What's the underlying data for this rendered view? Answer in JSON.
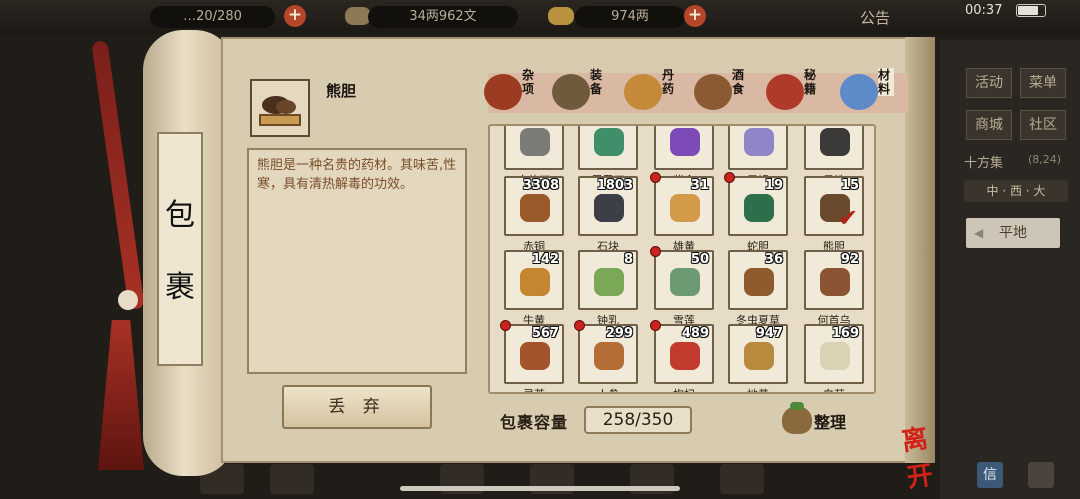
{
  "status": {
    "time": "00:37"
  },
  "topbar": {
    "capacity_text": "…20/280",
    "money": "34两962文",
    "gold": "974两",
    "notice": "公告",
    "add_label": "+"
  },
  "side": {
    "buttons": [
      "活动",
      "菜单",
      "商城",
      "社区"
    ],
    "location": "十方集",
    "coords": "(8,24)",
    "direction": "中 · 西 · 大",
    "place": "平地",
    "place_arrow": "◀",
    "letter": "信"
  },
  "scroll": {
    "char1": "包",
    "char2": "裹"
  },
  "item": {
    "name": "熊胆",
    "description": "熊胆是一种名贵的药材。其味苦,性寒，具有清热解毒的功效。"
  },
  "discard_label": "丢 弃",
  "tabs": [
    {
      "label": "杂项",
      "color": "#9a3b22"
    },
    {
      "label": "装备",
      "color": "#6f5b3c"
    },
    {
      "label": "丹药",
      "color": "#c48a3a"
    },
    {
      "label": "酒食",
      "color": "#8a5b33"
    },
    {
      "label": "秘籍",
      "color": "#b03a2a"
    },
    {
      "label": "材料",
      "color": "#5f8ac9"
    }
  ],
  "active_tab": "材料",
  "grid": {
    "rows": [
      [
        {
          "name": "白练石",
          "qty": "",
          "badge": false,
          "color": "#7d7b78"
        },
        {
          "name": "昆吾石",
          "qty": "",
          "badge": false,
          "color": "#3e8f6a"
        },
        {
          "name": "紫金",
          "qty": "",
          "badge": false,
          "color": "#7c4bb8"
        },
        {
          "name": "雪银",
          "qty": "",
          "badge": false,
          "color": "#8f86c9"
        },
        {
          "name": "黑铁",
          "qty": "",
          "badge": false,
          "color": "#3b3a38"
        }
      ],
      [
        {
          "name": "赤铜",
          "qty": "3308",
          "badge": false,
          "color": "#9b5a2a"
        },
        {
          "name": "石块",
          "qty": "1803",
          "badge": false,
          "color": "#3c3f45"
        },
        {
          "name": "雄黄",
          "qty": "31",
          "badge": true,
          "color": "#d39a47"
        },
        {
          "name": "蛇胆",
          "qty": "19",
          "badge": true,
          "color": "#2d6f4a"
        },
        {
          "name": "熊胆",
          "qty": "15",
          "badge": false,
          "color": "#6a4a2c",
          "selected": true
        }
      ],
      [
        {
          "name": "牛黄",
          "qty": "142",
          "badge": false,
          "color": "#c4862e"
        },
        {
          "name": "钟乳",
          "qty": "8",
          "badge": false,
          "color": "#7aa856"
        },
        {
          "name": "雪莲",
          "qty": "50",
          "badge": true,
          "color": "#6c9a72"
        },
        {
          "name": "冬虫夏草",
          "qty": "36",
          "badge": false,
          "color": "#8f5a2e"
        },
        {
          "name": "何首乌",
          "qty": "92",
          "badge": false,
          "color": "#8b5533"
        }
      ],
      [
        {
          "name": "灵芝",
          "qty": "567",
          "badge": true,
          "color": "#a4542c"
        },
        {
          "name": "人参",
          "qty": "299",
          "badge": true,
          "color": "#b46d34"
        },
        {
          "name": "枸杞",
          "qty": "489",
          "badge": true,
          "color": "#c33b2e"
        },
        {
          "name": "地黄",
          "qty": "947",
          "badge": false,
          "color": "#b78a3e"
        },
        {
          "name": "白芍",
          "qty": "169",
          "badge": false,
          "color": "#d9d2b4"
        }
      ]
    ]
  },
  "capacity": {
    "label": "包裹容量",
    "value": "258/350"
  },
  "sort_label": "整理",
  "leave_label": "离开"
}
